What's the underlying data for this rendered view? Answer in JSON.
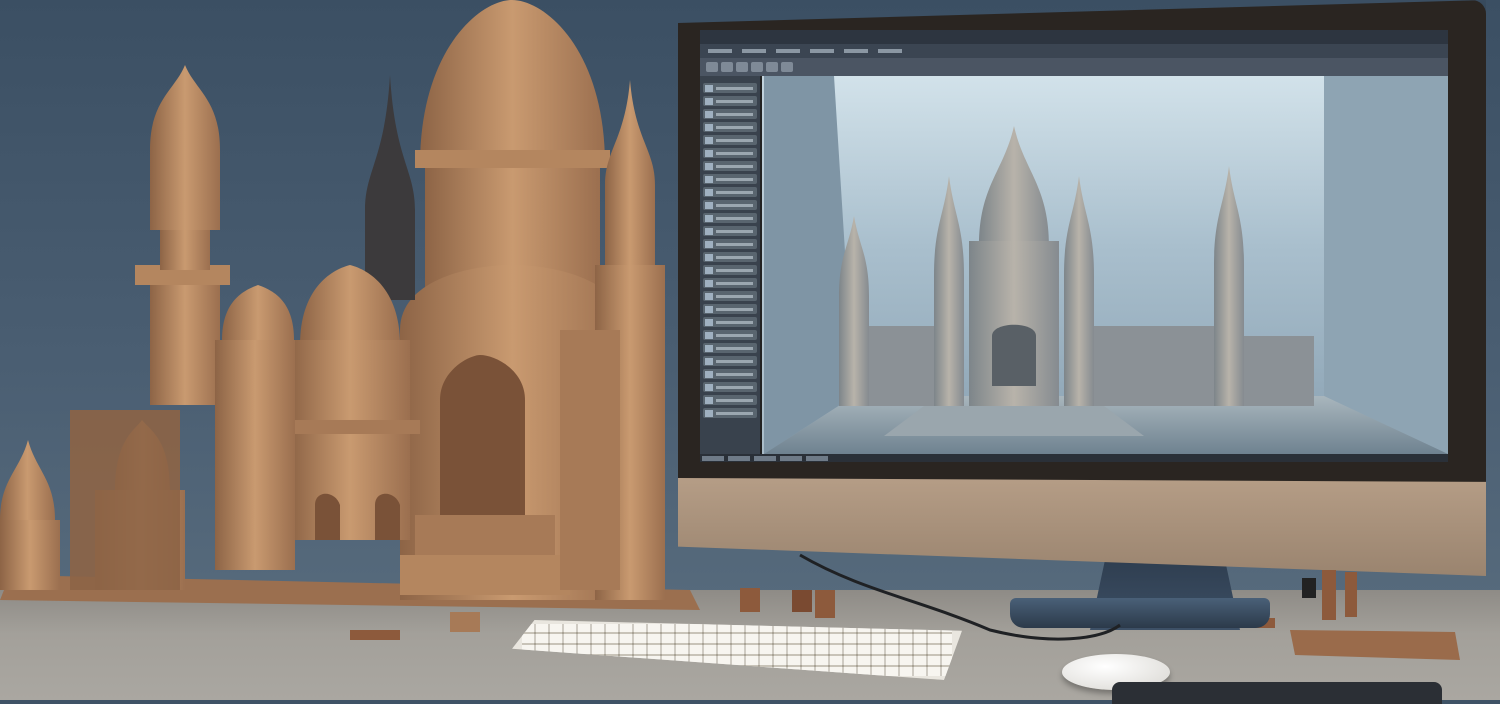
{
  "scene": {
    "description_tags": [
      "3d-model",
      "monitor",
      "keyboard",
      "mouse",
      "desk"
    ],
    "palette": {
      "wall": "#3f5366",
      "desk": "#a3a09a",
      "model": "#b98a63",
      "model_dark": "#8d6446",
      "screen_sky": "#c9dbe4",
      "monitor_bezel": "#2a2521"
    }
  },
  "app": {
    "menu": [
      "",
      "",
      "",
      "",
      "",
      ""
    ],
    "panel_rows": 26,
    "icons": [
      "cube-icon",
      "move-icon",
      "rotate-icon",
      "scale-icon",
      "camera-icon",
      "light-icon"
    ]
  }
}
